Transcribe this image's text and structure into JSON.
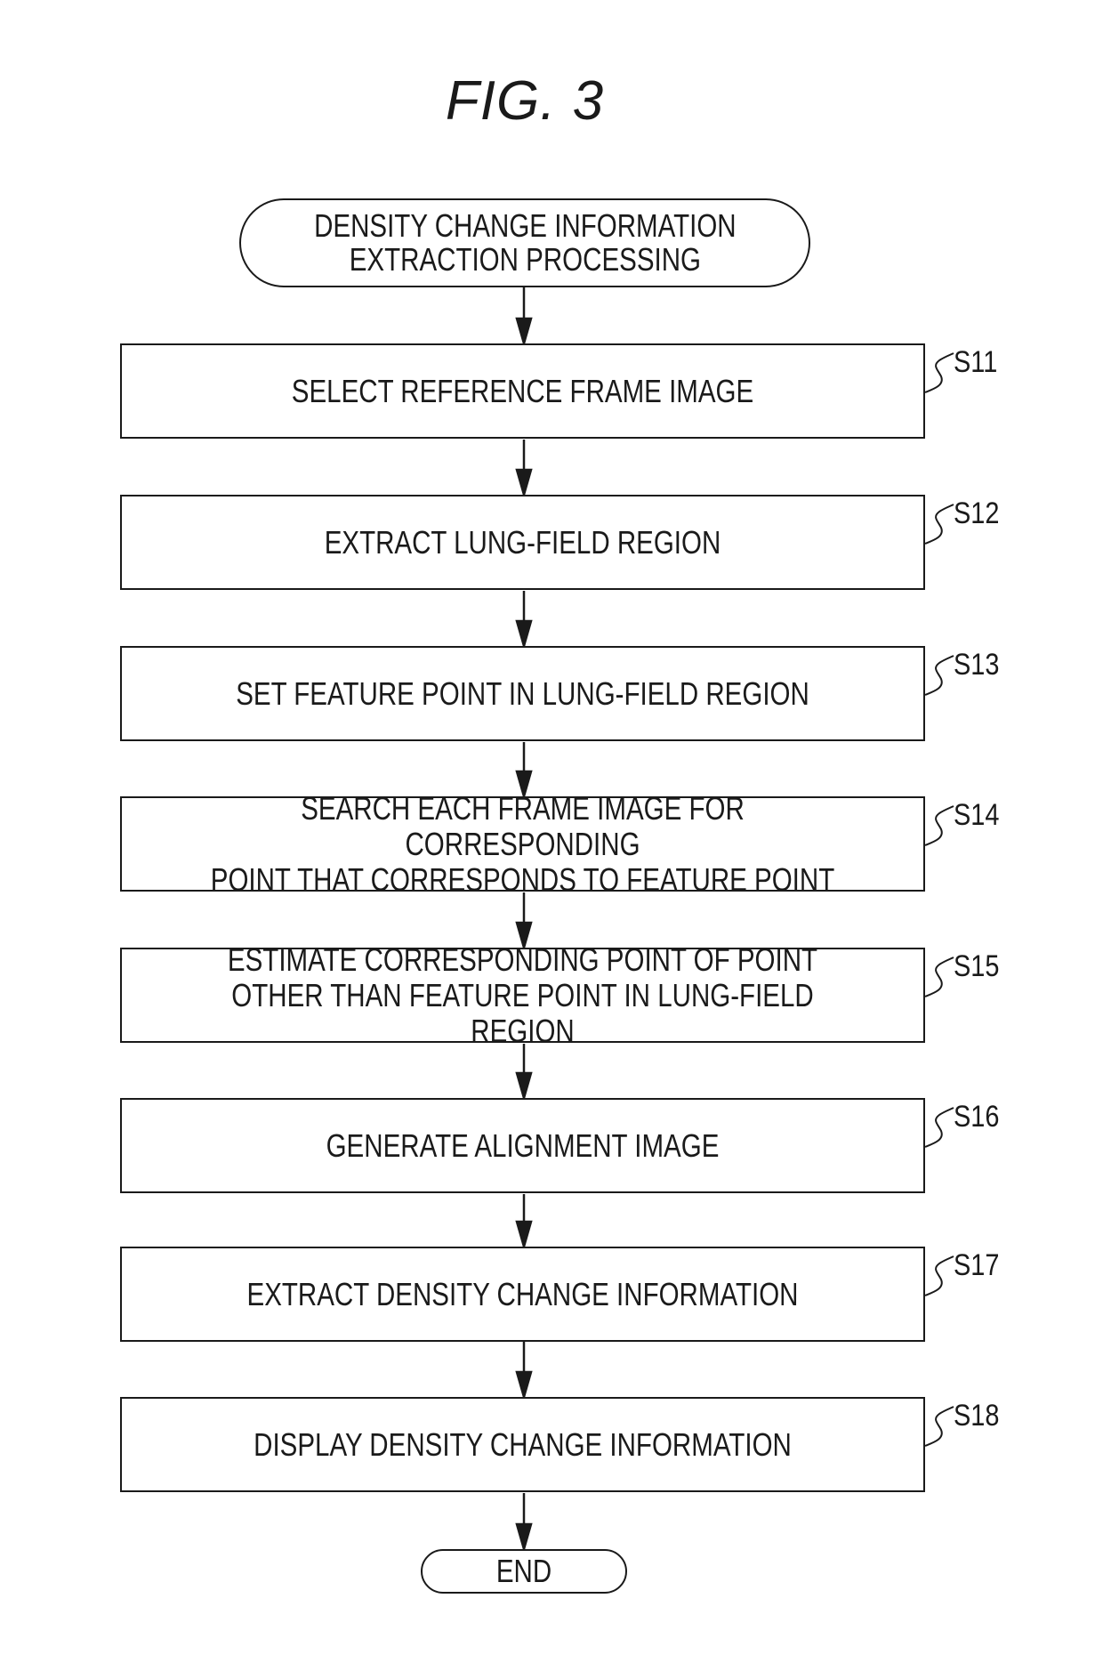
{
  "figure": {
    "title": "FIG. 3"
  },
  "flowchart": {
    "start": {
      "label": "DENSITY CHANGE INFORMATION\nEXTRACTION PROCESSING"
    },
    "steps": [
      {
        "id": "S11",
        "label": "SELECT REFERENCE FRAME IMAGE"
      },
      {
        "id": "S12",
        "label": "EXTRACT LUNG-FIELD REGION"
      },
      {
        "id": "S13",
        "label": "SET FEATURE POINT IN LUNG-FIELD REGION"
      },
      {
        "id": "S14",
        "label": "SEARCH EACH FRAME IMAGE FOR CORRESPONDING\nPOINT THAT CORRESPONDS TO FEATURE POINT"
      },
      {
        "id": "S15",
        "label": "ESTIMATE CORRESPONDING POINT OF POINT\nOTHER THAN FEATURE POINT IN LUNG-FIELD REGION"
      },
      {
        "id": "S16",
        "label": "GENERATE ALIGNMENT IMAGE"
      },
      {
        "id": "S17",
        "label": "EXTRACT DENSITY CHANGE INFORMATION"
      },
      {
        "id": "S18",
        "label": "DISPLAY DENSITY CHANGE INFORMATION"
      }
    ],
    "end": {
      "label": "END"
    }
  }
}
